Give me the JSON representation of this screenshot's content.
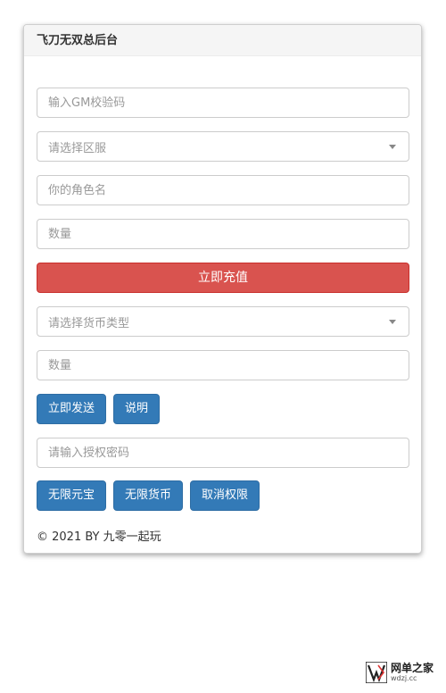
{
  "panel": {
    "title": "飞刀无双总后台"
  },
  "form": {
    "gm_code_placeholder": "输入GM校验码",
    "server_select_label": "请选择区服",
    "role_name_placeholder": "你的角色名",
    "quantity1_placeholder": "数量",
    "recharge_button": "立即充值",
    "currency_select_label": "请选择货币类型",
    "quantity2_placeholder": "数量",
    "send_button": "立即发送",
    "explain_button": "说明",
    "auth_password_placeholder": "请输入授权密码",
    "unlimited_yuanbao_button": "无限元宝",
    "unlimited_currency_button": "无限货币",
    "revoke_button": "取消权限"
  },
  "footer": {
    "copyright": "© 2021 BY 九零一起玩"
  },
  "watermark": {
    "main": "网单之家",
    "sub": "wdzj.cc"
  },
  "colors": {
    "danger": "#d9534f",
    "primary": "#337ab7"
  }
}
